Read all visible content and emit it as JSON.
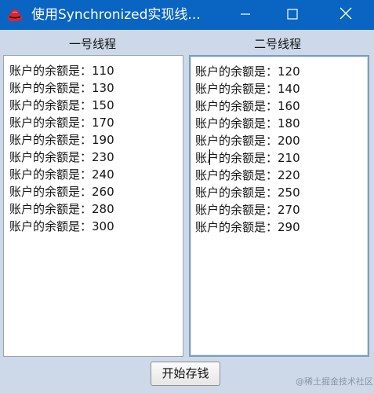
{
  "window": {
    "title": "使用Synchronized实现线...",
    "controls": {
      "minimize": "minimize",
      "maximize": "maximize",
      "close": "close"
    },
    "accent_color": "#0a64c2"
  },
  "columns": [
    {
      "header": "一号线程",
      "lines": [
        "账户的余额是：110",
        "账户的余额是：130",
        "账户的余额是：150",
        "账户的余额是：170",
        "账户的余额是：190",
        "账户的余额是：230",
        "账户的余额是：240",
        "账户的余额是：260",
        "账户的余额是：280",
        "账户的余额是：300"
      ]
    },
    {
      "header": "二号线程",
      "lines": [
        "账户的余额是：120",
        "账户的余额是：140",
        "账户的余额是：160",
        "账户的余额是：180",
        "账户的余额是：200",
        "账户的余额是：210",
        "账户的余额是：220",
        "账户的余额是：250",
        "账户的余额是：270",
        "账户的余额是：290"
      ]
    }
  ],
  "start_button": {
    "label": "开始存钱"
  },
  "watermark": {
    "text": "@稀土掘金技术社区"
  }
}
